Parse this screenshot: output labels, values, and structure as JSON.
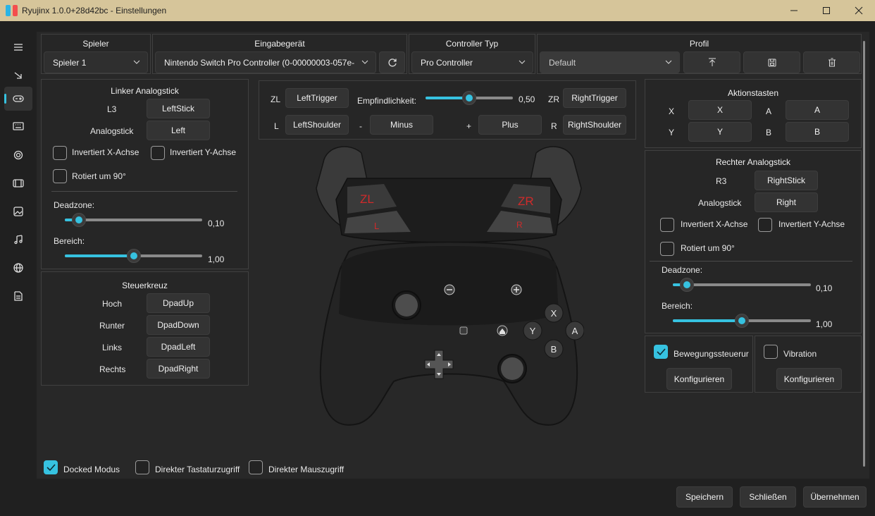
{
  "window": {
    "title": "Ryujinx 1.0.0+28d42bc - Einstellungen"
  },
  "sidebar": {
    "icons": [
      "menu-icon",
      "arrow-down-right-icon",
      "gamepad-icon",
      "keyboard-icon",
      "gear-icon",
      "film-icon",
      "image-icon",
      "music-icon",
      "globe-icon",
      "document-icon"
    ]
  },
  "header": {
    "player": {
      "label": "Spieler",
      "value": "Spieler 1"
    },
    "device": {
      "label": "Eingabegerät",
      "value": "Nintendo Switch Pro Controller (0-00000003-057e-"
    },
    "controller": {
      "label": "Controller Typ",
      "value": "Pro Controller"
    },
    "profile": {
      "label": "Profil",
      "value": "Default"
    }
  },
  "left_stick": {
    "title": "Linker Analogstick",
    "button_label": "L3",
    "button_value": "LeftStick",
    "stick_label": "Analogstick",
    "stick_value": "Left",
    "invert_x": "Invertiert X-Achse",
    "invert_y": "Invertiert Y-Achse",
    "rotate": "Rotiert um 90°",
    "deadzone_label": "Deadzone:",
    "deadzone_value": "0,10",
    "deadzone": 0.1,
    "range_label": "Bereich:",
    "range_value": "1,00",
    "range": 1.0
  },
  "dpad": {
    "title": "Steuerkreuz",
    "rows": [
      {
        "label": "Hoch",
        "value": "DpadUp"
      },
      {
        "label": "Runter",
        "value": "DpadDown"
      },
      {
        "label": "Links",
        "value": "DpadLeft"
      },
      {
        "label": "Rechts",
        "value": "DpadRight"
      }
    ]
  },
  "triggers": {
    "zl_label": "ZL",
    "zl_value": "LeftTrigger",
    "sensitivity_label": "Empfindlichkeit:",
    "sensitivity_value": "0,50",
    "sensitivity": 0.5,
    "zr_label": "ZR",
    "zr_value": "RightTrigger",
    "l_label": "L",
    "l_value": "LeftShoulder",
    "minus_label": "-",
    "minus_value": "Minus",
    "plus_label": "+",
    "plus_value": "Plus",
    "r_label": "R",
    "r_value": "RightShoulder"
  },
  "controller_image": {
    "zl": "ZL",
    "zr": "ZR",
    "l": "L",
    "r": "R",
    "x": "X",
    "y": "Y",
    "a": "A",
    "b": "B"
  },
  "action_buttons": {
    "title": "Aktionstasten",
    "x_label": "X",
    "x_value": "X",
    "a_label": "A",
    "a_value": "A",
    "y_label": "Y",
    "y_value": "Y",
    "b_label": "B",
    "b_value": "B"
  },
  "right_stick": {
    "title": "Rechter Analogstick",
    "button_label": "R3",
    "button_value": "RightStick",
    "stick_label": "Analogstick",
    "stick_value": "Right",
    "invert_x": "Invertiert X-Achse",
    "invert_y": "Invertiert Y-Achse",
    "rotate": "Rotiert um 90°",
    "deadzone_label": "Deadzone:",
    "deadzone_value": "0,10",
    "deadzone": 0.1,
    "range_label": "Bereich:",
    "range_value": "1,00",
    "range": 1.0
  },
  "motion": {
    "label": "Bewegungssteuerur",
    "checked": true,
    "configure": "Konfigurieren"
  },
  "vibration": {
    "label": "Vibration",
    "checked": false,
    "configure": "Konfigurieren"
  },
  "options": {
    "docked": {
      "label": "Docked Modus",
      "checked": true
    },
    "keyboard": {
      "label": "Direkter Tastaturzugriff",
      "checked": false
    },
    "mouse": {
      "label": "Direkter Mauszugriff",
      "checked": false
    }
  },
  "footer": {
    "save": "Speichern",
    "close": "Schließen",
    "apply": "Übernehmen"
  },
  "colors": {
    "accent": "#36c2e0",
    "titlebar": "#d6c59a",
    "background": "#202020"
  }
}
